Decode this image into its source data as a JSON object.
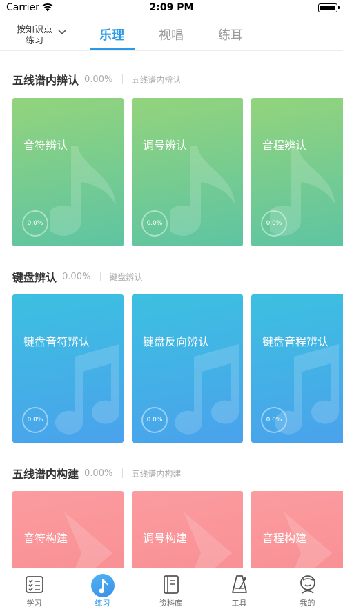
{
  "status": {
    "carrier": "Carrier",
    "time": "2:09 PM"
  },
  "header": {
    "filter_label": "按知识点练习",
    "tabs": [
      {
        "label": "乐理",
        "active": true
      },
      {
        "label": "视唱",
        "active": false
      },
      {
        "label": "练耳",
        "active": false
      }
    ],
    "accent": "#2a9ae8"
  },
  "sections": [
    {
      "title": "五线谱内辨认",
      "percent": "0.00%",
      "subtitle": "五线谱内辨认",
      "color": "green",
      "cards": [
        {
          "label": "音符辨认",
          "progress": "0.0%"
        },
        {
          "label": "调号辨认",
          "progress": "0.0%"
        },
        {
          "label": "音程辨认",
          "progress": "0.0%"
        }
      ]
    },
    {
      "title": "键盘辨认",
      "percent": "0.00%",
      "subtitle": "键盘辨认",
      "color": "blue",
      "cards": [
        {
          "label": "键盘音符辨认",
          "progress": "0.0%"
        },
        {
          "label": "键盘反向辨认",
          "progress": "0.0%"
        },
        {
          "label": "键盘音程辨认",
          "progress": "0.0%"
        }
      ]
    },
    {
      "title": "五线谱内构建",
      "percent": "0.00%",
      "subtitle": "五线谱内构建",
      "color": "red",
      "cards": [
        {
          "label": "音符构建"
        },
        {
          "label": "调号构建"
        },
        {
          "label": "音程构建"
        }
      ]
    }
  ],
  "tabbar": [
    {
      "label": "学习",
      "icon": "checklist-icon",
      "active": false
    },
    {
      "label": "练习",
      "icon": "music-note-icon",
      "active": true
    },
    {
      "label": "资料库",
      "icon": "book-icon",
      "active": false
    },
    {
      "label": "工具",
      "icon": "metronome-icon",
      "active": false
    },
    {
      "label": "我的",
      "icon": "profile-icon",
      "active": false
    }
  ]
}
